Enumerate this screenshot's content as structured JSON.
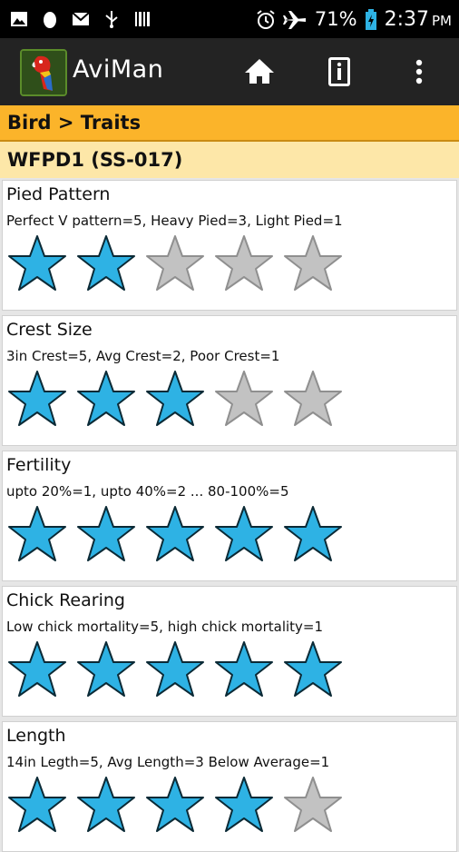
{
  "status_bar": {
    "battery": "71%",
    "time": "2:37",
    "ampm": "PM",
    "icons": [
      "image-icon",
      "egg-icon",
      "gmail-icon",
      "usb-icon",
      "barcode-icon",
      "alarm-icon",
      "airplane-icon",
      "battery-icon"
    ]
  },
  "action_bar": {
    "app_name": "AviMan",
    "icons": [
      "home-icon",
      "info-icon",
      "overflow-menu-icon"
    ]
  },
  "breadcrumb": "Bird > Traits",
  "bird_id": "WFPD1 (SS-017)",
  "colors": {
    "star_filled": "#2eb2e4",
    "star_empty": "#c2c2c2",
    "breadcrumb_bg": "#fbb42a",
    "bird_bar_bg": "#fde7a8"
  },
  "traits": [
    {
      "title": "Pied Pattern",
      "description": "Perfect V pattern=5, Heavy Pied=3, Light Pied=1",
      "rating": 2,
      "max": 5
    },
    {
      "title": "Crest Size",
      "description": "3in Crest=5, Avg Crest=2, Poor Crest=1",
      "rating": 3,
      "max": 5
    },
    {
      "title": "Fertility",
      "description": "upto 20%=1, upto 40%=2 ... 80-100%=5",
      "rating": 5,
      "max": 5
    },
    {
      "title": "Chick Rearing",
      "description": "Low chick mortality=5, high chick mortality=1",
      "rating": 5,
      "max": 5
    },
    {
      "title": "Length",
      "description": "14in Legth=5, Avg Length=3 Below Average=1",
      "rating": 4,
      "max": 5
    }
  ]
}
